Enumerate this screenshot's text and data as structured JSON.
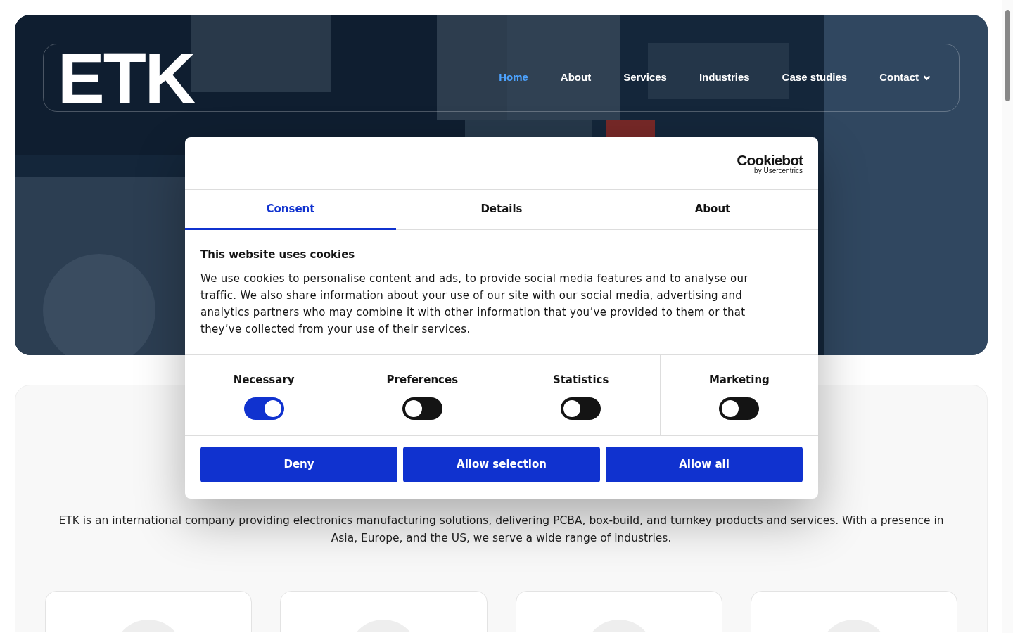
{
  "header": {
    "logo": "ETK",
    "nav": [
      {
        "label": "Home",
        "selected": true,
        "dropdown": false
      },
      {
        "label": "About",
        "selected": false,
        "dropdown": false
      },
      {
        "label": "Services",
        "selected": false,
        "dropdown": false
      },
      {
        "label": "Industries",
        "selected": false,
        "dropdown": false
      },
      {
        "label": "Case studies",
        "selected": false,
        "dropdown": false
      },
      {
        "label": "Contact",
        "selected": false,
        "dropdown": true
      }
    ]
  },
  "intro": {
    "text": "ETK is an international company providing electronics manufacturing solutions, delivering PCBA, box-build, and turnkey products and services. With a presence in Asia, Europe, and the US, we serve a wide range of industries."
  },
  "feature_cards": [
    {
      "kind": "placeholder"
    },
    {
      "kind": "placeholder"
    },
    {
      "kind": "placeholder"
    },
    {
      "kind": "placeholder"
    }
  ],
  "cookie_dialog": {
    "brand": "Cookiebot",
    "brand_sub": "by Usercentrics",
    "tabs": [
      {
        "label": "Consent",
        "selected": true
      },
      {
        "label": "Details",
        "selected": false
      },
      {
        "label": "About",
        "selected": false
      }
    ],
    "title": "This website uses cookies",
    "body": "We use cookies to personalise content and ads, to provide social media features and to analyse our traffic. We also share information about your use of our site with our social media, advertising and analytics partners who may combine it with other information that you’ve provided to them or that they’ve collected from your use of their services.",
    "categories": [
      {
        "label": "Necessary",
        "on": true
      },
      {
        "label": "Preferences",
        "on": false
      },
      {
        "label": "Statistics",
        "on": false
      },
      {
        "label": "Marketing",
        "on": false
      }
    ],
    "buttons": [
      "Deny",
      "Allow selection",
      "Allow all"
    ]
  }
}
